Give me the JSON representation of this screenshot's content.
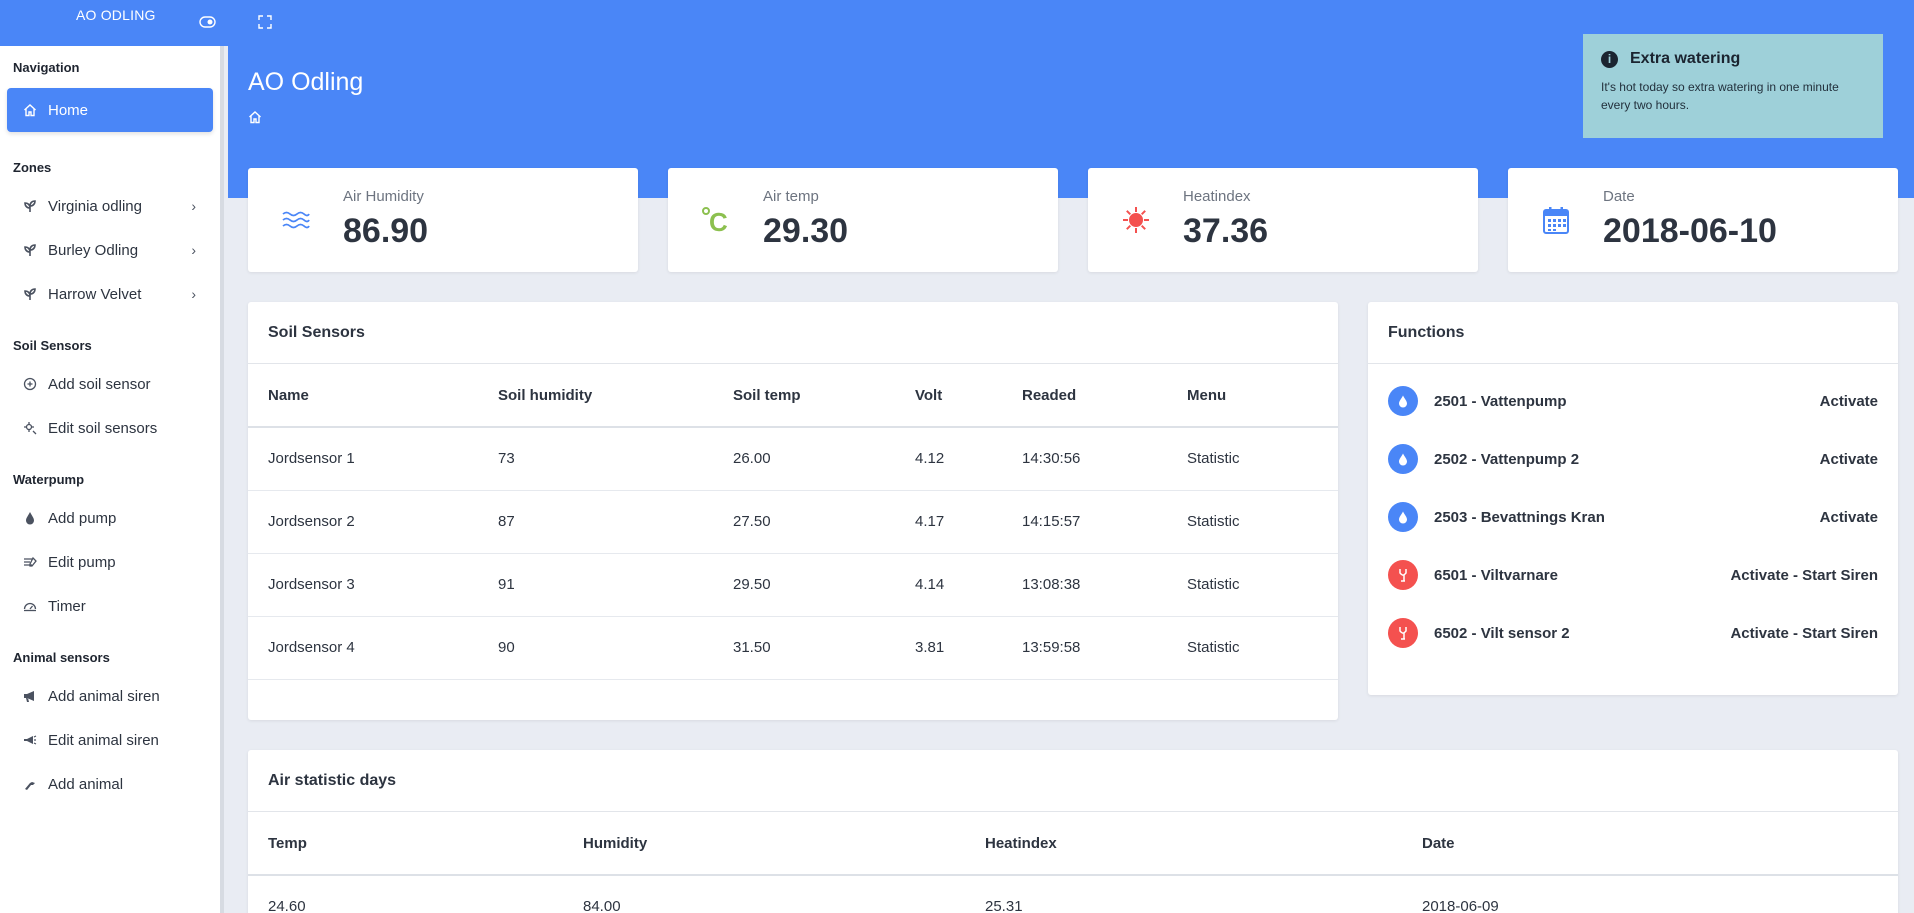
{
  "topbar": {
    "brand": "AO ODLING"
  },
  "sidebar": {
    "sections": {
      "navigation": "Navigation",
      "zones": "Zones",
      "soil": "Soil Sensors",
      "waterpump": "Waterpump",
      "animal": "Animal sensors"
    },
    "items": {
      "home": "Home",
      "virginia": "Virginia odling",
      "burley": "Burley Odling",
      "harrow": "Harrow Velvet",
      "add_soil": "Add soil sensor",
      "edit_soil": "Edit soil sensors",
      "add_pump": "Add pump",
      "edit_pump": "Edit pump",
      "timer": "Timer",
      "add_siren": "Add animal siren",
      "edit_siren": "Edit animal siren",
      "add_animal": "Add animal"
    }
  },
  "header": {
    "title": "AO Odling"
  },
  "toast": {
    "title": "Extra watering",
    "body": "It's hot today so extra watering in one minute every two hours."
  },
  "stats": [
    {
      "label": "Air Humidity",
      "value": "86.90",
      "icon": "water-waves-icon",
      "color": "#4a86f7"
    },
    {
      "label": "Air temp",
      "value": "29.30",
      "icon": "celsius-icon",
      "color": "#8cc04f"
    },
    {
      "label": "Heatindex",
      "value": "37.36",
      "icon": "sun-icon",
      "color": "#f4514f"
    },
    {
      "label": "Date",
      "value": "2018-06-10",
      "icon": "calendar-icon",
      "color": "#4a86f7"
    }
  ],
  "soil": {
    "title": "Soil Sensors",
    "columns": [
      "Name",
      "Soil humidity",
      "Soil temp",
      "Volt",
      "Readed",
      "Menu"
    ],
    "rows": [
      [
        "Jordsensor 1",
        "73",
        "26.00",
        "4.12",
        "14:30:56",
        "Statistic"
      ],
      [
        "Jordsensor 2",
        "87",
        "27.50",
        "4.17",
        "14:15:57",
        "Statistic"
      ],
      [
        "Jordsensor 3",
        "91",
        "29.50",
        "4.14",
        "13:08:38",
        "Statistic"
      ],
      [
        "Jordsensor 4",
        "90",
        "31.50",
        "3.81",
        "13:59:58",
        "Statistic"
      ]
    ]
  },
  "functions": {
    "title": "Functions",
    "items": [
      {
        "name": "2501 - Vattenpump",
        "action": "Activate",
        "icon": "water-drop-icon",
        "color": "#4a86f7"
      },
      {
        "name": "2502 - Vattenpump 2",
        "action": "Activate",
        "icon": "water-drop-icon",
        "color": "#4a86f7"
      },
      {
        "name": "2503 - Bevattnings Kran",
        "action": "Activate",
        "icon": "water-drop-icon",
        "color": "#4a86f7"
      },
      {
        "name": "6501 - Viltvarnare",
        "action": "Activate - Start Siren",
        "icon": "deer-icon",
        "color": "#f4514f"
      },
      {
        "name": "6502 - Vilt sensor 2",
        "action": "Activate - Start Siren",
        "icon": "deer-icon",
        "color": "#f4514f"
      }
    ]
  },
  "air": {
    "title": "Air statistic days",
    "columns": [
      "Temp",
      "Humidity",
      "Heatindex",
      "Date"
    ],
    "rows": [
      [
        "24.60",
        "84.00",
        "25.31",
        "2018-06-09"
      ]
    ]
  }
}
